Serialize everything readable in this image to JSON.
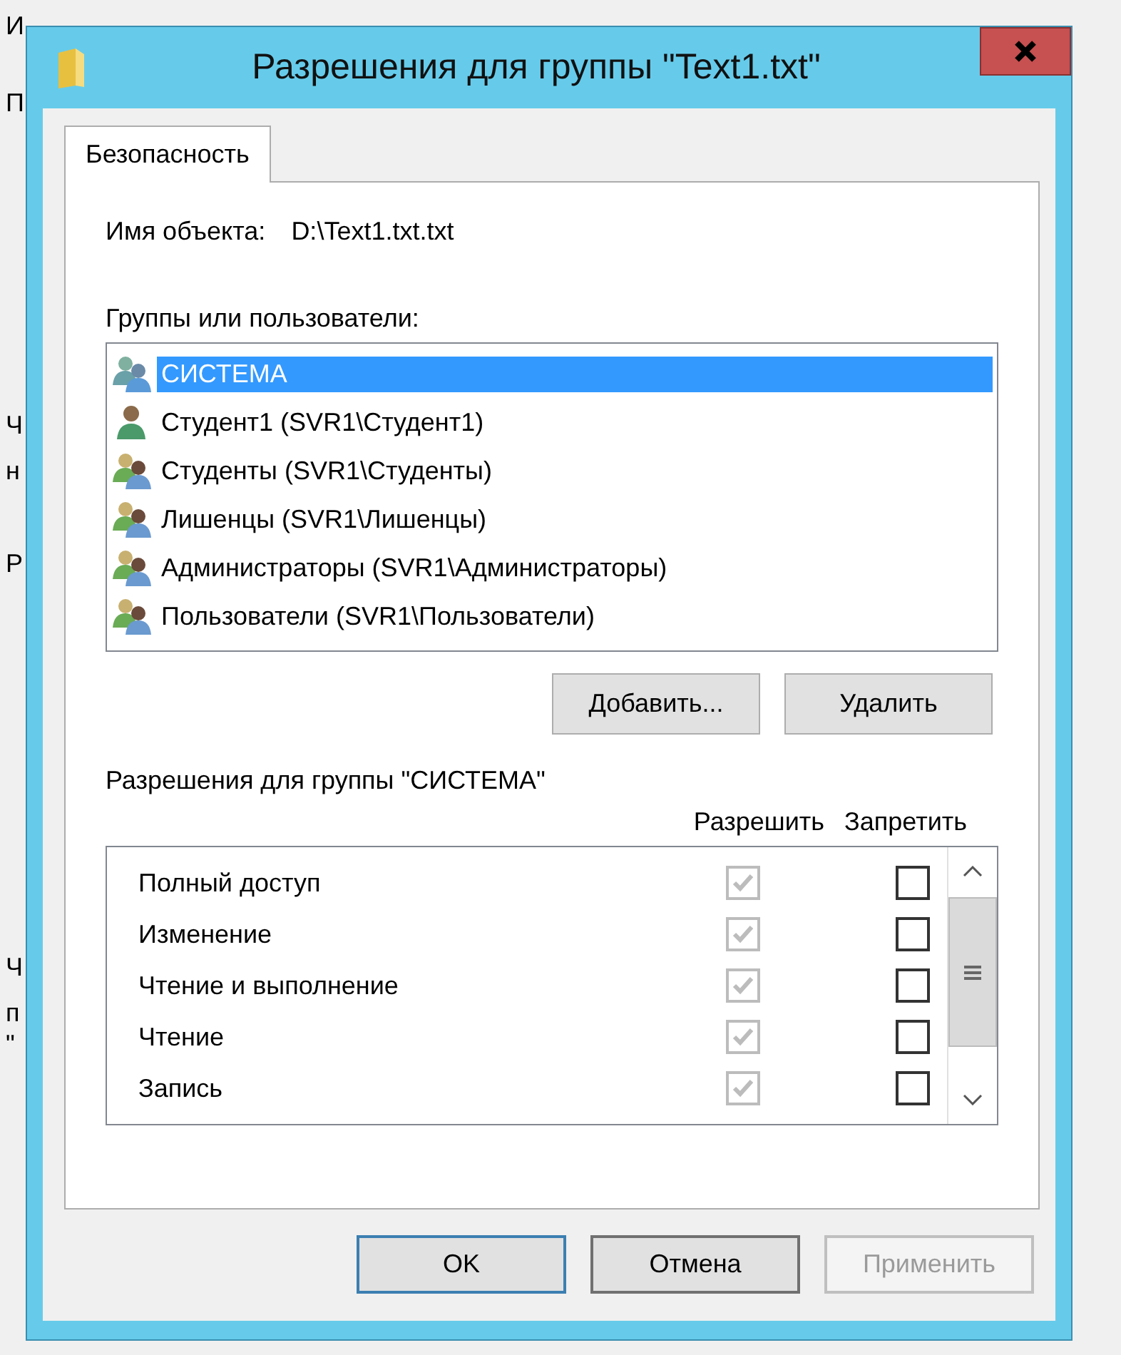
{
  "background_window": {
    "fragments": [
      "И",
      "П",
      "Ч",
      "н",
      "Р",
      "Ч",
      "п",
      "\""
    ]
  },
  "dialog": {
    "title": "Разрешения для группы \"Text1.txt\"",
    "tabs": [
      {
        "label": "Безопасность",
        "selected": true
      }
    ],
    "object_name": {
      "label": "Имя объекта:",
      "value": "D:\\Text1.txt.txt"
    },
    "groups_label": "Группы или пользователи:",
    "groups": [
      {
        "name": "СИСТЕМА",
        "kind": "system",
        "selected": true
      },
      {
        "name": "Студент1 (SVR1\\Студент1)",
        "kind": "user",
        "selected": false
      },
      {
        "name": "Студенты (SVR1\\Студенты)",
        "kind": "group",
        "selected": false
      },
      {
        "name": "Лишенцы (SVR1\\Лишенцы)",
        "kind": "group",
        "selected": false
      },
      {
        "name": "Администраторы (SVR1\\Администраторы)",
        "kind": "group",
        "selected": false
      },
      {
        "name": "Пользователи (SVR1\\Пользователи)",
        "kind": "group",
        "selected": false
      }
    ],
    "group_buttons": [
      {
        "label": "Добавить..."
      },
      {
        "label": "Удалить"
      }
    ],
    "permissions_label": "Разрешения для группы \"СИСТЕМА\"",
    "columns": [
      "Разрешить",
      "Запретить"
    ],
    "permissions": [
      {
        "name": "Полный доступ",
        "allow": {
          "checked": true,
          "disabled": true
        },
        "deny": {
          "checked": false,
          "disabled": false
        }
      },
      {
        "name": "Изменение",
        "allow": {
          "checked": true,
          "disabled": true
        },
        "deny": {
          "checked": false,
          "disabled": false
        }
      },
      {
        "name": "Чтение и выполнение",
        "allow": {
          "checked": true,
          "disabled": true
        },
        "deny": {
          "checked": false,
          "disabled": false
        }
      },
      {
        "name": "Чтение",
        "allow": {
          "checked": true,
          "disabled": true
        },
        "deny": {
          "checked": false,
          "disabled": false
        }
      },
      {
        "name": "Запись",
        "allow": {
          "checked": true,
          "disabled": true
        },
        "deny": {
          "checked": false,
          "disabled": false
        }
      }
    ],
    "footer_buttons": [
      {
        "label": "OK",
        "kind": "default",
        "disabled": false
      },
      {
        "label": "Отмена",
        "kind": "normal",
        "disabled": false
      },
      {
        "label": "Применить",
        "kind": "normal",
        "disabled": true
      }
    ]
  }
}
